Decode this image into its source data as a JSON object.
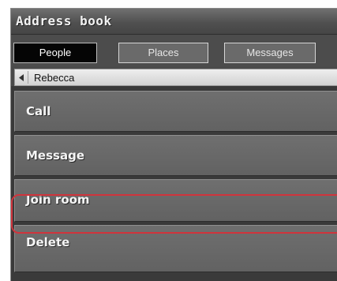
{
  "window": {
    "title": "Address book"
  },
  "tabs": [
    {
      "label": "People",
      "active": true
    },
    {
      "label": "Places",
      "active": false
    },
    {
      "label": "Messages",
      "active": false
    }
  ],
  "breadcrumb": {
    "back_icon": "caret-left-icon",
    "label": "Rebecca"
  },
  "actions": [
    {
      "label": "Call"
    },
    {
      "label": "Message"
    },
    {
      "label": "Join room",
      "highlighted": true
    },
    {
      "label": "Delete"
    }
  ],
  "colors": {
    "highlight": "#d0343c",
    "active_tab": "#050505",
    "panel": "#4a4a4a"
  }
}
